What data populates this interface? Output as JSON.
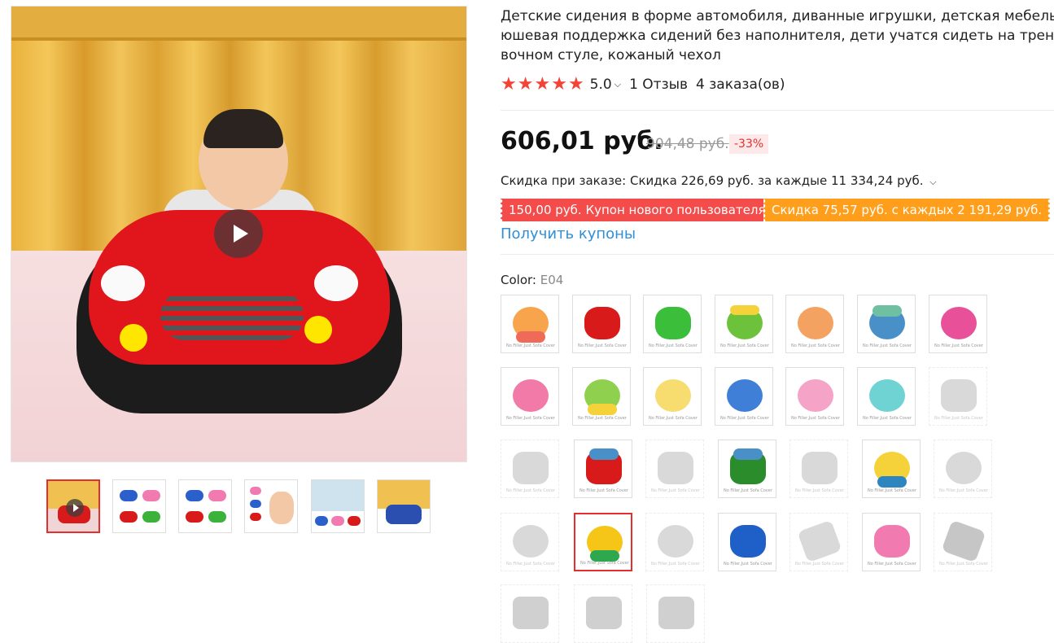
{
  "product": {
    "title_lines": [
      "Детские сидения в форме автомобиля, диванные игрушки, детская мебель, пл",
      "юшевая поддержка сидений без наполнителя, дети учатся сидеть на трениро",
      "вочном стуле, кожаный чехол"
    ],
    "rating": "5.0",
    "reviews": "1 Отзыв",
    "orders": "4 заказа(ов)",
    "stars": 5,
    "price": "606,01 руб.",
    "old_price": "904,48 руб.",
    "discount_badge": "-33%",
    "order_discount": "Скидка при заказе: Скидка 226,69 руб. за каждые 11 334,24 руб.",
    "coupon_new_user": "150,00 руб. Купон нового пользователя",
    "coupon_spend": "Скидка 75,57 руб. с каждых 2 191,29 руб.",
    "get_coupons": "Получить купоны",
    "color_label": "Color:",
    "color_value": "E04"
  },
  "swatch_caption": "No Filler,Just Sofa Cover",
  "colors": {
    "accent_red": "#e62e2e",
    "star": "#f44336",
    "link": "#2f8fd8",
    "coupon_red": "#f44b4b",
    "coupon_orange": "#ff9e1a"
  },
  "icons": [
    "play-icon",
    "star-icon",
    "chevron-down-icon"
  ]
}
